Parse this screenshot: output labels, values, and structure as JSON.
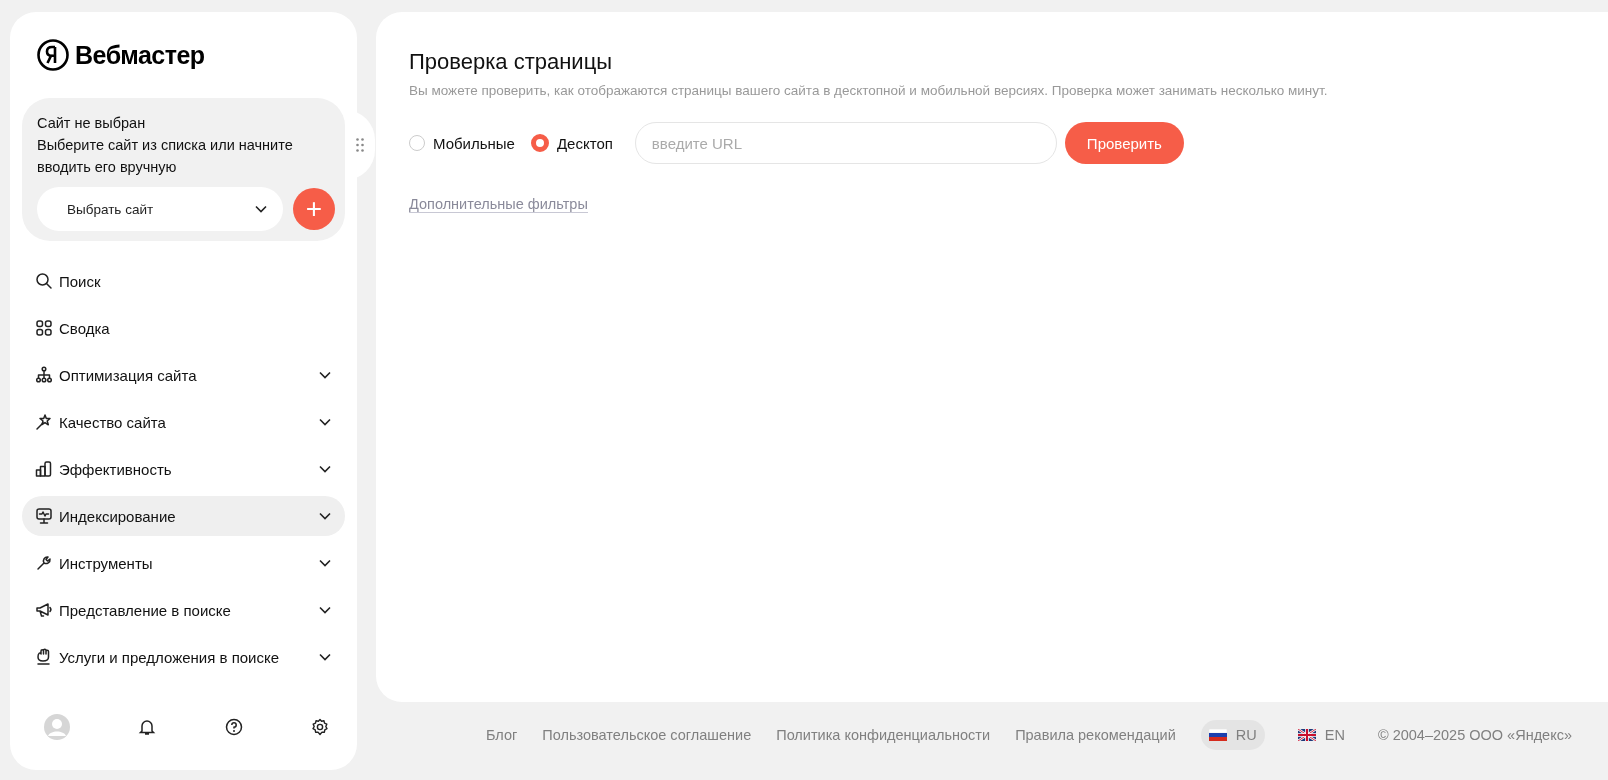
{
  "logo": {
    "text": "Вебмастер"
  },
  "site_card": {
    "title": "Сайт не выбран",
    "hint": "Выберите сайт из списка или начните вводить его вручную",
    "select": {
      "value": "Выбрать сайт"
    },
    "add_button": "+"
  },
  "nav": [
    {
      "label": "Поиск",
      "expandable": false,
      "selected": false
    },
    {
      "label": "Сводка",
      "expandable": false,
      "selected": false
    },
    {
      "label": "Оптимизация сайта",
      "expandable": true,
      "selected": false
    },
    {
      "label": "Качество сайта",
      "expandable": true,
      "selected": false
    },
    {
      "label": "Эффективность",
      "expandable": true,
      "selected": false
    },
    {
      "label": "Индексирование",
      "expandable": true,
      "selected": true
    },
    {
      "label": "Инструменты",
      "expandable": true,
      "selected": false
    },
    {
      "label": "Представление в поиске",
      "expandable": true,
      "selected": false
    },
    {
      "label": "Услуги и предложения в поиске",
      "expandable": true,
      "selected": false
    }
  ],
  "page": {
    "title": "Проверка страницы",
    "subtitle": "Вы можете проверить, как отображаются страницы вашего сайта в десктопной и мобильной версиях. Проверка может занимать несколько минут.",
    "modes": [
      {
        "label": "Мобильные",
        "selected": false
      },
      {
        "label": "Десктоп",
        "selected": true
      }
    ],
    "url_field": {
      "placeholder": "введите URL"
    },
    "check_button": "Проверить",
    "filters_link": "Дополнительные фильтры"
  },
  "footer": {
    "links": [
      "Блог",
      "Пользовательское соглашение",
      "Политика конфиденциальности",
      "Правила рекомендаций"
    ],
    "languages": [
      {
        "label": "RU",
        "selected": true,
        "kind": "ru"
      },
      {
        "label": "EN",
        "selected": false,
        "kind": "en"
      }
    ],
    "copyright": "© 2004–2025 ООО «Яндекс»"
  }
}
